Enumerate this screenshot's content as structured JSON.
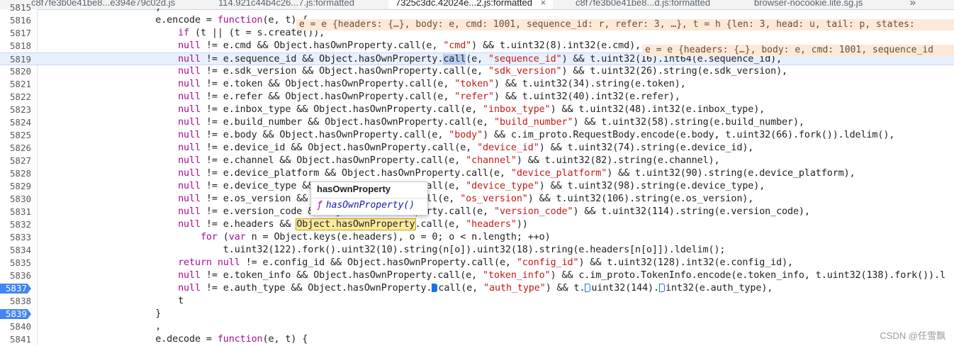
{
  "tabs": [
    {
      "label": "c8f7fe3b0e41be8...e394e79c02d.js",
      "active": false
    },
    {
      "label": "114.921c44b4c26...7.js:formatted",
      "active": false
    },
    {
      "label": "7325c3dc.42024e...2.js:formatted",
      "active": true
    },
    {
      "label": "c8f7fe3b0e41be8...d.js:formatted",
      "active": false
    },
    {
      "label": "browser-nocookie.lite.sg.js",
      "active": false
    }
  ],
  "tab_close_glyph": "×",
  "tab_overflow_glyph": "»",
  "lines": [
    {
      "num": "5815",
      "text": "                    ,"
    },
    {
      "num": "5816",
      "text": "                    e.encode = function(e, t) {"
    },
    {
      "num": "5817",
      "text": "                        if (t || (t = s.create()),"
    },
    {
      "num": "5818",
      "text": "                        null != e.cmd && Object.hasOwnProperty.call(e, \"cmd\") && t.uint32(8).int32(e.cmd),"
    },
    {
      "num": "5819",
      "text": "                        null != e.sequence_id && Object.hasOwnProperty.call(e, \"sequence_id\") && t.uint32(16).int64(e.sequence_id),"
    },
    {
      "num": "5820",
      "text": "                        null != e.sdk_version && Object.hasOwnProperty.call(e, \"sdk_version\") && t.uint32(26).string(e.sdk_version),"
    },
    {
      "num": "5821",
      "text": "                        null != e.token && Object.hasOwnProperty.call(e, \"token\") && t.uint32(34).string(e.token),"
    },
    {
      "num": "5822",
      "text": "                        null != e.refer && Object.hasOwnProperty.call(e, \"refer\") && t.uint32(40).int32(e.refer),"
    },
    {
      "num": "5823",
      "text": "                        null != e.inbox_type && Object.hasOwnProperty.call(e, \"inbox_type\") && t.uint32(48).int32(e.inbox_type),"
    },
    {
      "num": "5824",
      "text": "                        null != e.build_number && Object.hasOwnProperty.call(e, \"build_number\") && t.uint32(58).string(e.build_number),"
    },
    {
      "num": "5825",
      "text": "                        null != e.body && Object.hasOwnProperty.call(e, \"body\") && c.im_proto.RequestBody.encode(e.body, t.uint32(66).fork()).ldelim(),"
    },
    {
      "num": "5826",
      "text": "                        null != e.device_id && Object.hasOwnProperty.call(e, \"device_id\") && t.uint32(74).string(e.device_id),"
    },
    {
      "num": "5827",
      "text": "                        null != e.channel && Object.hasOwnProperty.call(e, \"channel\") && t.uint32(82).string(e.channel),"
    },
    {
      "num": "5828",
      "text": "                        null != e.device_platform && Object.hasOwnProperty.call(e, \"device_platform\") && t.uint32(90).string(e.device_platform),"
    },
    {
      "num": "5829",
      "text": "                        null != e.device_type && Ob                call(e, \"device_type\") && t.uint32(98).string(e.device_type),"
    },
    {
      "num": "5830",
      "text": "                        null != e.os_version && Ob                call(e, \"os_version\") && t.uint32(106).string(e.os_version),"
    },
    {
      "num": "5831",
      "text": "                        null != e.version_code && Object.hasOwnProperty.call(e, \"version_code\") && t.uint32(114).string(e.version_code),"
    },
    {
      "num": "5832",
      "text": "                        null != e.headers && Object.hasOwnProperty.call(e, \"headers\"))"
    },
    {
      "num": "5833",
      "text": "                            for (var n = Object.keys(e.headers), o = 0; o < n.length; ++o)"
    },
    {
      "num": "5834",
      "text": "                                t.uint32(122).fork().uint32(10).string(n[o]).uint32(18).string(e.headers[n[o]]).ldelim();"
    },
    {
      "num": "5835",
      "text": "                        return null != e.config_id && Object.hasOwnProperty.call(e, \"config_id\") && t.uint32(128).int32(e.config_id),"
    },
    {
      "num": "5836",
      "text": "                        null != e.token_info && Object.hasOwnProperty.call(e, \"token_info\") && c.im_proto.TokenInfo.encode(e.token_info, t.uint32(138).fork()).l"
    },
    {
      "num": "5837",
      "text": "                        null != e.auth_type && Object.hasOwnProperty. call(e, \"auth_type\") && t. uint32(144). int32(e.auth_type),"
    },
    {
      "num": "5838",
      "text": "                        t"
    },
    {
      "num": "5839",
      "text": "                    }"
    },
    {
      "num": "5840",
      "text": "                    ,"
    },
    {
      "num": "5841",
      "text": "                    e.decode = function(e, t) {"
    }
  ],
  "breakpoints": [
    "5837",
    "5839"
  ],
  "current_line": "5819",
  "inline_hints": {
    "line_5816": "e = e {headers: {…}, body: e, cmd: 1001, sequence_id: r, refer: 3, …}, t = h {len: 3, head: u, tail: p, states:",
    "line_5818": "e = e {headers: {…}, body: e, cmd: 1001, sequence_id"
  },
  "tooltip": {
    "title": "hasOwnProperty",
    "fn_glyph": "ƒ",
    "signature": "hasOwnProperty()"
  },
  "watermark": "CSDN @任雪飘",
  "colors": {
    "keyword": "#aa0d91",
    "string": "#c41a16",
    "breakpoint": "#4285f4",
    "inline_hint_bg": "#fde9d9",
    "current_line_bg": "#e8f0fe"
  }
}
